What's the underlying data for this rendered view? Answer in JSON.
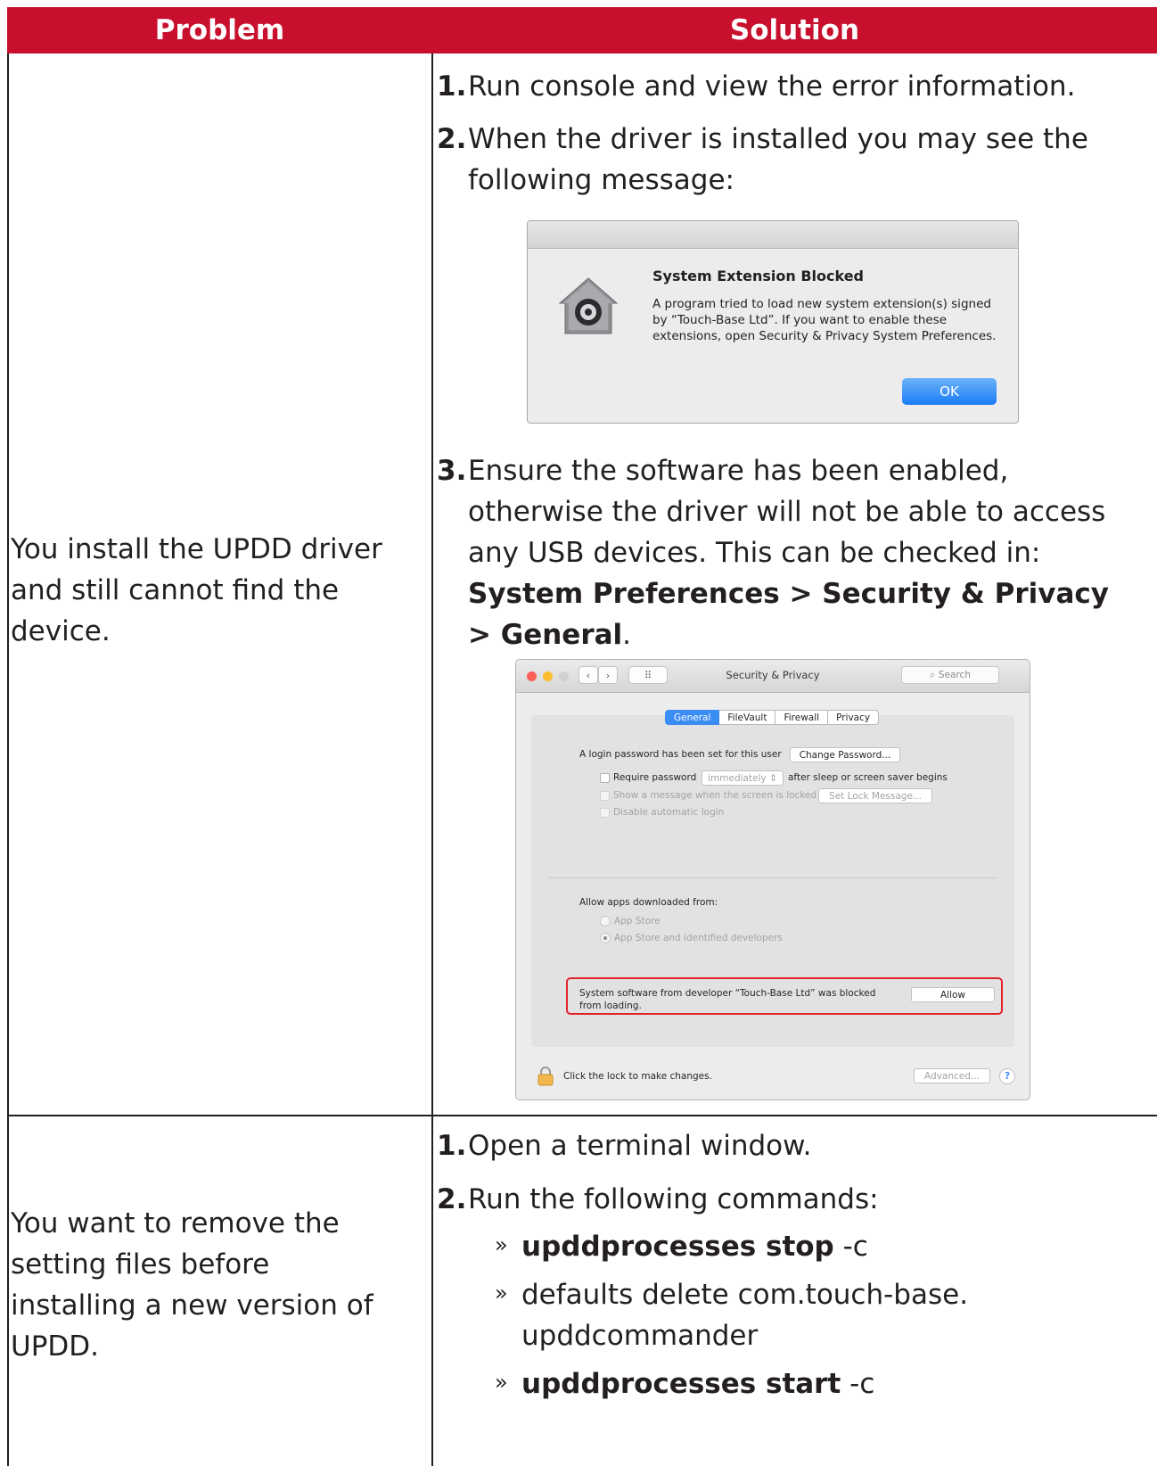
{
  "header": {
    "problem": "Problem",
    "solution": "Solution"
  },
  "row1": {
    "problem": "You install the UPDD driver and still cannot find the device.",
    "step1": {
      "num": "1.",
      "text": "Run console and view the error information."
    },
    "step2": {
      "num": "2.",
      "text": "When the driver is installed you may see the following message:"
    },
    "step3": {
      "num": "3.",
      "text_a": "Ensure the software has been enabled, otherwise the driver will not be able to access any USB devices. This can be checked in: ",
      "bold": "System Preferences > Security & Privacy > General",
      "text_b": "."
    }
  },
  "alert": {
    "title": "System Extension Blocked",
    "body": "A program tried to load new system extension(s) signed by “Touch-Base Ltd”.  If you want to enable these extensions, open Security & Privacy System Preferences.",
    "ok": "OK",
    "icon": "security-house-lock-icon"
  },
  "prefs": {
    "title": "Security & Privacy",
    "search": "Search",
    "grid": "⠿",
    "tabs": [
      "General",
      "FileVault",
      "Firewall",
      "Privacy"
    ],
    "login_text": "A login password has been set for this user",
    "change_password": "Change Password...",
    "require_password": "Require password",
    "immediately": "immediately",
    "after_sleep": "after sleep or screen saver begins",
    "show_message": "Show a message when the screen is locked",
    "set_lock_message": "Set Lock Message...",
    "disable_login": "Disable automatic login",
    "allow_apps": "Allow apps downloaded from:",
    "app_store": "App Store",
    "app_store_identified": "App Store and identified developers",
    "blocked_line1": "System software from developer “Touch-Base Ltd” was blocked",
    "blocked_line2": "from loading.",
    "allow": "Allow",
    "lock_text": "Click the lock to make changes.",
    "advanced": "Advanced...",
    "help": "?"
  },
  "row2": {
    "problem": "You want to remove the setting files before installing a new version of UPDD.",
    "step1": {
      "num": "1.",
      "text": "Open a terminal window."
    },
    "step2": {
      "num": "2.",
      "text": "Run the following commands:"
    },
    "bullet": "»",
    "cmd1": {
      "bold": "upddprocesses stop",
      "rest": " -c"
    },
    "cmd2": {
      "text": "defaults delete com.touch-base. upddcommander"
    },
    "cmd3": {
      "bold": "upddprocesses start",
      "rest": " -c"
    }
  }
}
